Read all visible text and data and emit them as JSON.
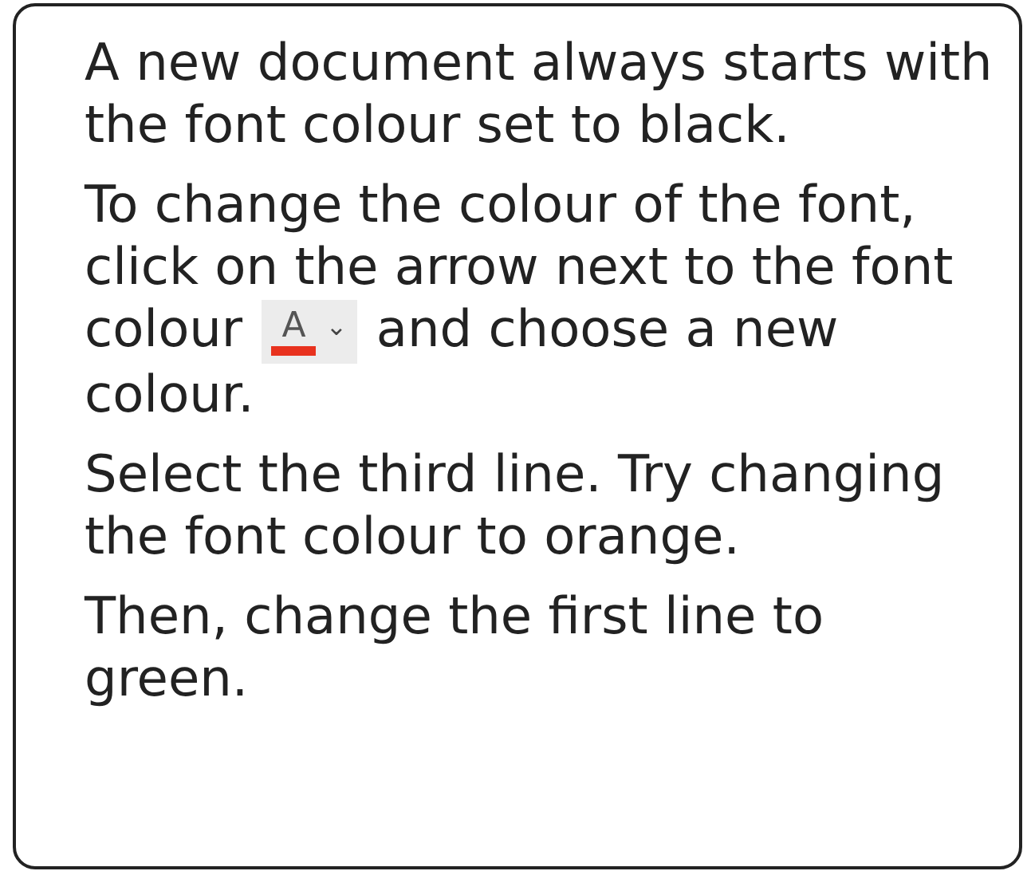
{
  "paragraphs": [
    {
      "kind": "text",
      "text": "A new document always starts with the font colour set to black."
    },
    {
      "kind": "icon_text",
      "before": "To change the colour of the font, click on the arrow next to the font colour",
      "after": "and choose a new colour.",
      "icon": {
        "letter": "A",
        "glyph": "⌄",
        "color": "#e8321e"
      }
    },
    {
      "kind": "text",
      "text": "Select the third line. Try changing the font colour to orange."
    },
    {
      "kind": "text",
      "text": "Then, change the first line to green."
    }
  ]
}
